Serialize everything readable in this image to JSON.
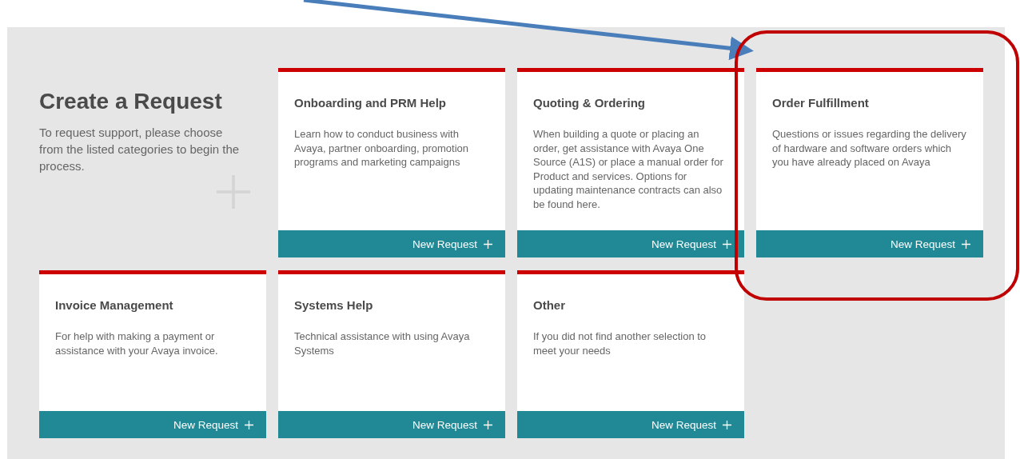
{
  "intro": {
    "title": "Create a Request",
    "description": "To request support, please choose from the listed categories to begin the process."
  },
  "categories": [
    {
      "title": "Onboarding and PRM Help",
      "description": "Learn how to conduct business with Avaya, partner onboarding, promotion programs and marketing campaigns",
      "button": "New Request"
    },
    {
      "title": "Quoting & Ordering",
      "description": "When building a quote or placing an order, get assistance with Avaya One Source (A1S) or place a manual order for Product and services. Options for updating maintenance contracts can also be found here.",
      "button": "New Request"
    },
    {
      "title": "Order Fulfillment",
      "description": "Questions or issues regarding the delivery of hardware and software orders which you have already placed on Avaya",
      "button": "New Request"
    },
    {
      "title": "Invoice Management",
      "description": "For help with making a payment or assistance with your Avaya invoice.",
      "button": "New Request"
    },
    {
      "title": "Systems Help",
      "description": "Technical assistance with using Avaya Systems",
      "button": "New Request"
    },
    {
      "title": "Other",
      "description": "If you did not find another selection to meet your needs",
      "button": "New Request"
    }
  ]
}
